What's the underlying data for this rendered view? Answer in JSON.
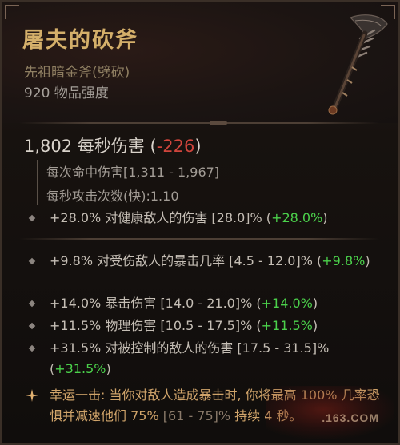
{
  "item": {
    "name": "屠夫的砍斧",
    "type": "先祖暗金斧(劈砍)",
    "power": "920 物品强度"
  },
  "dps": {
    "value": "1,802",
    "label": "每秒伤害",
    "paren_open": "(",
    "diff": "-226",
    "paren_close": ")",
    "diff_color": "#d0453c"
  },
  "weapon_stats": [
    "每次命中伤害[1,311 - 1,967]",
    "每秒攻击次数(快):1.10"
  ],
  "implicit": {
    "text": "+28.0% 对健康敌人的伤害 [28.0]% (",
    "delta": "+28.0%",
    "close": ")"
  },
  "affixes": [
    {
      "text": "+9.8% 对受伤敌人的暴击几率 [4.5 - 12.0]% (",
      "delta": "+9.8%",
      "close": ")"
    },
    {
      "text": "+14.0% 暴击伤害 [14.0 - 21.0]% (",
      "delta": "+14.0%",
      "close": ")"
    },
    {
      "text": "+11.5% 物理伤害 [10.5 - 17.5]% (",
      "delta": "+11.5%",
      "close": ")"
    },
    {
      "text": "+31.5% 对被控制的敌人的伤害 [17.5 - 31.5]% (",
      "delta": "+31.5%",
      "close": ")"
    }
  ],
  "unique_power": {
    "prefix": "幸运一击: 当你对敌人造成暴击时, 你将最高 100% 几率恐惧并减速他们 75% ",
    "range": "[61 - 75]%",
    "suffix": " 持续 4 秒。"
  },
  "watermark": ".163.COM",
  "colors": {
    "title": "#d4af6a",
    "positive_delta": "#4bd14b",
    "negative_delta": "#d0453c",
    "unique_text": "#d0a46a"
  },
  "icons": {
    "bullet": "diamond-bullet-icon",
    "unique": "unique-star-icon",
    "item": "axe-icon"
  }
}
